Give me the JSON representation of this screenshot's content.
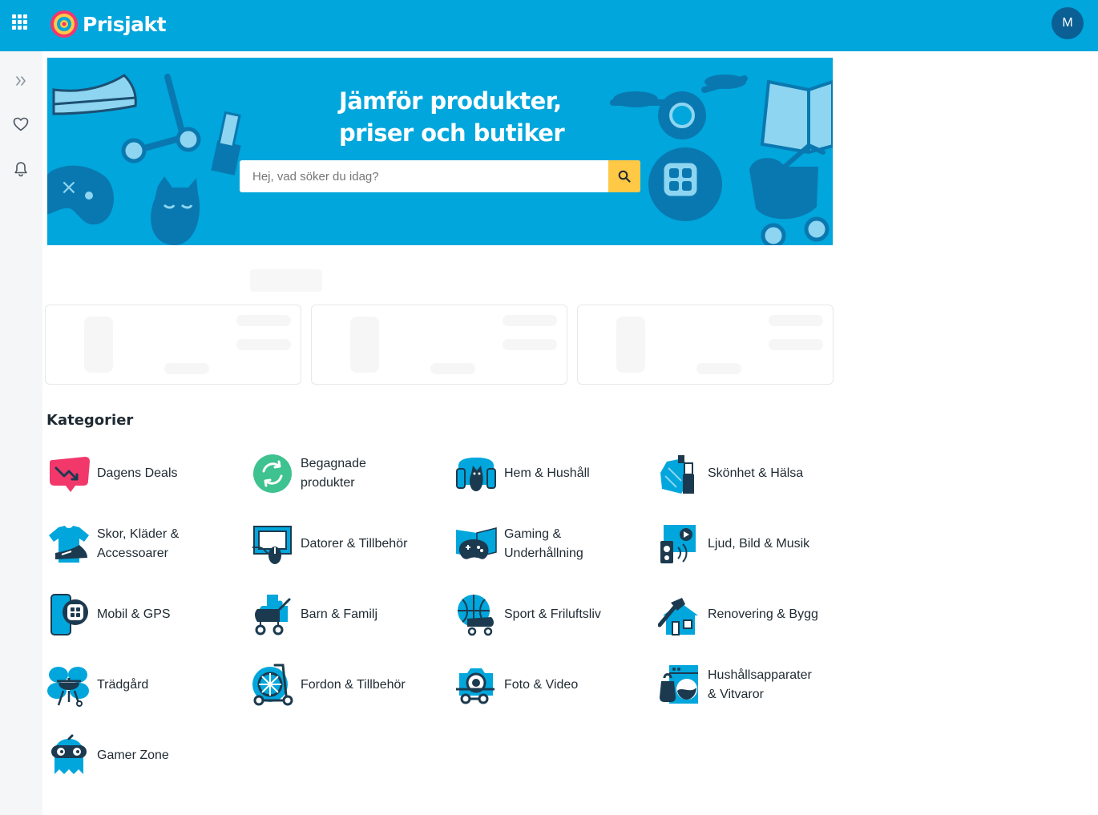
{
  "header": {
    "brand": "Prisjakt",
    "avatar_initial": "M"
  },
  "rail": {
    "items": [
      {
        "icon": "double-chevron-right-icon"
      },
      {
        "icon": "heart-icon"
      },
      {
        "icon": "bell-icon"
      }
    ]
  },
  "hero": {
    "title_line1": "Jämför produkter,",
    "title_line2": "priser och butiker",
    "search_placeholder": "Hej, vad söker du idag?"
  },
  "categories": {
    "heading": "Kategorier",
    "items": [
      {
        "label": "Dagens Deals",
        "icon": "deals-icon"
      },
      {
        "label": "Begagnade\nprodukter",
        "icon": "recycle-icon"
      },
      {
        "label": "Hem & Hushåll",
        "icon": "home-icon"
      },
      {
        "label": "Skönhet & Hälsa",
        "icon": "beauty-icon"
      },
      {
        "label": "Skor, Kläder &\nAccessoarer",
        "icon": "clothes-icon"
      },
      {
        "label": "Datorer & Tillbehör",
        "icon": "computer-icon"
      },
      {
        "label": "Gaming &\nUnderhållning",
        "icon": "gaming-icon"
      },
      {
        "label": "Ljud, Bild & Musik",
        "icon": "media-icon"
      },
      {
        "label": "Mobil & GPS",
        "icon": "mobile-icon"
      },
      {
        "label": "Barn & Familj",
        "icon": "stroller-icon"
      },
      {
        "label": "Sport & Friluftsliv",
        "icon": "sport-icon"
      },
      {
        "label": "Renovering & Bygg",
        "icon": "renovation-icon"
      },
      {
        "label": "Trädgård",
        "icon": "garden-icon"
      },
      {
        "label": "Fordon & Tillbehör",
        "icon": "vehicle-icon"
      },
      {
        "label": "Foto & Video",
        "icon": "camera-icon"
      },
      {
        "label": "Hushållsapparater\n& Vitvaror",
        "icon": "appliance-icon"
      },
      {
        "label": "Gamer Zone",
        "icon": "gamer-zone-icon"
      }
    ]
  },
  "colors": {
    "brand": "#00a6dc",
    "avatar": "#0a5f94",
    "search_button": "#ffc845",
    "deals": "#f2386b",
    "recycle": "#3ec28f",
    "icon_blue": "#00a6dc",
    "icon_dark": "#1c3a4f"
  }
}
